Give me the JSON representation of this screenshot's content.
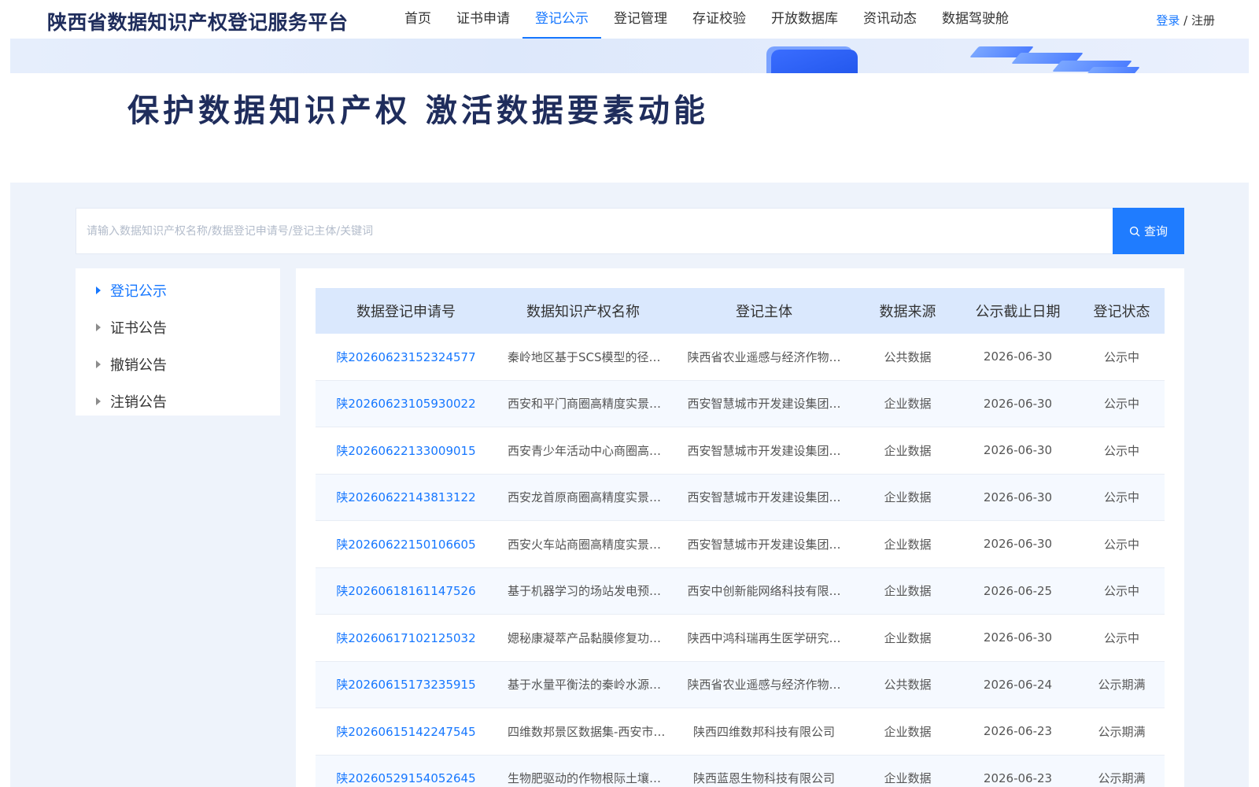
{
  "header": {
    "site_title": "陕西省数据知识产权登记服务平台",
    "nav": [
      {
        "label": "首页",
        "active": false
      },
      {
        "label": "证书申请",
        "active": false
      },
      {
        "label": "登记公示",
        "active": true
      },
      {
        "label": "登记管理",
        "active": false
      },
      {
        "label": "存证校验",
        "active": false
      },
      {
        "label": "开放数据库",
        "active": false
      },
      {
        "label": "资讯动态",
        "active": false
      },
      {
        "label": "数据驾驶舱",
        "active": false
      }
    ],
    "login_label": "登录",
    "separator": " / ",
    "register_label": "注册"
  },
  "banner": {
    "slogan": "保护数据知识产权 激活数据要素动能"
  },
  "search": {
    "placeholder": "请输入数据知识产权名称/数据登记申请号/登记主体/关键词",
    "value": "",
    "button_label": "查询"
  },
  "side_menu": {
    "items": [
      {
        "label": "登记公示",
        "active": true
      },
      {
        "label": "证书公告",
        "active": false
      },
      {
        "label": "撤销公告",
        "active": false
      },
      {
        "label": "注销公告",
        "active": false
      }
    ]
  },
  "table": {
    "headers": [
      "数据登记申请号",
      "数据知识产权名称",
      "登记主体",
      "数据来源",
      "公示截止日期",
      "登记状态"
    ],
    "rows": [
      [
        "陕20260623152324577",
        "秦岭地区基于SCS模型的径…",
        "陕西省农业遥感与经济作物…",
        "公共数据",
        "2026-06-30",
        "公示中"
      ],
      [
        "陕20260623105930022",
        "西安和平门商圈高精度实景…",
        "西安智慧城市开发建设集团…",
        "企业数据",
        "2026-06-30",
        "公示中"
      ],
      [
        "陕20260622133009015",
        "西安青少年活动中心商圈高…",
        "西安智慧城市开发建设集团…",
        "企业数据",
        "2026-06-30",
        "公示中"
      ],
      [
        "陕20260622143813122",
        "西安龙首原商圈高精度实景…",
        "西安智慧城市开发建设集团…",
        "企业数据",
        "2026-06-30",
        "公示中"
      ],
      [
        "陕20260622150106605",
        "西安火车站商圈高精度实景…",
        "西安智慧城市开发建设集团…",
        "企业数据",
        "2026-06-30",
        "公示中"
      ],
      [
        "陕20260618161147526",
        "基于机器学习的场站发电预…",
        "西安中创新能网络科技有限…",
        "企业数据",
        "2026-06-25",
        "公示中"
      ],
      [
        "陕20260617102125032",
        "媤秘康凝萃产品黏膜修复功…",
        "陕西中鸿科瑞再生医学研究…",
        "企业数据",
        "2026-06-30",
        "公示中"
      ],
      [
        "陕20260615173235915",
        "基于水量平衡法的秦岭水源…",
        "陕西省农业遥感与经济作物…",
        "公共数据",
        "2026-06-24",
        "公示期满"
      ],
      [
        "陕20260615142247545",
        "四维数邦景区数据集-西安市…",
        "陕西四维数邦科技有限公司",
        "企业数据",
        "2026-06-23",
        "公示期满"
      ],
      [
        "陕20260529154052645",
        "生物肥驱动的作物根际土壤…",
        "陕西蓝恩生物科技有限公司",
        "企业数据",
        "2026-06-23",
        "公示期满"
      ]
    ]
  },
  "colors": {
    "accent": "#1677ff",
    "title": "#1f2d5c",
    "header_row": "#dae8fd",
    "page_bg": "#eef3fb"
  }
}
